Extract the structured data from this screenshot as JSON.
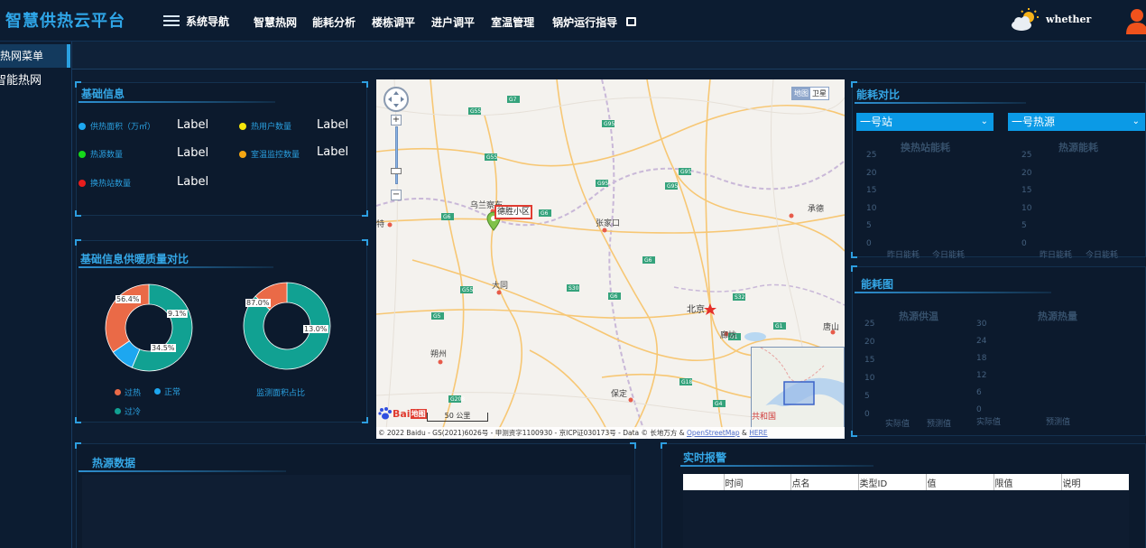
{
  "header": {
    "brand": "智慧供热云平台",
    "nav_toggle": "系统导航",
    "menu": [
      "智慧热网",
      "能耗分析",
      "楼栋调平",
      "进户调平",
      "室温管理",
      "锅炉运行指导"
    ],
    "weather": "whether"
  },
  "sidebar": {
    "items": [
      {
        "label": "热网菜单",
        "active": true
      },
      {
        "label": "智能热网",
        "active": false
      }
    ]
  },
  "basic_info": {
    "title": "基础信息",
    "rows": [
      {
        "label": "供热面积（万㎡）",
        "value": "Label",
        "color": "#1da7f0"
      },
      {
        "label": "热用户数量",
        "value": "Label",
        "color": "#f5e60b"
      },
      {
        "label": "热源数量",
        "value": "Label",
        "color": "#16d81a"
      },
      {
        "label": "室温监控数量",
        "value": "Label",
        "color": "#f5a612"
      },
      {
        "label": "换热站数量",
        "value": "Label",
        "color": "#e81d1d"
      }
    ]
  },
  "quality": {
    "title": "基础信息供暖质量对比",
    "legend": [
      {
        "label": "过热",
        "color": "#ea6a47"
      },
      {
        "label": "正常",
        "color": "#1da7f0"
      },
      {
        "label": "过冷",
        "color": "#11a192"
      }
    ],
    "monitor_label": "监测面积占比"
  },
  "chart_data": [
    {
      "type": "pie",
      "labels": [
        "过冷",
        "正常",
        "过热"
      ],
      "values": [
        56.4,
        9.1,
        34.5
      ],
      "value_labels": [
        "56.4%",
        "9.1%",
        "34.5%"
      ],
      "colors": [
        "#11a192",
        "#1da7f0",
        "#ea6a47"
      ],
      "donut": true
    },
    {
      "type": "pie",
      "values": [
        87.0,
        13.0
      ],
      "value_labels": [
        "87.0%",
        "13.0%"
      ],
      "colors": [
        "#11a192",
        "#ea6a47"
      ],
      "donut": true
    }
  ],
  "map": {
    "type_map": "地图",
    "type_sat": "卫星",
    "marker_label": "德胜小区",
    "scale_label": "50 公里",
    "copyright_prefix": "© 2022 Baidu - GS(2021)6026号 - 甲测资字1100930 - 京ICP证030173号 - Data © 长地万方 & ",
    "osm": "OpenStreetMap",
    "amp": " & ",
    "here": "HERE",
    "cities": [
      {
        "name": "乌兰察布"
      },
      {
        "name": "张家口"
      },
      {
        "name": "承德"
      },
      {
        "name": "大同"
      },
      {
        "name": "北京"
      },
      {
        "name": "廊坊"
      },
      {
        "name": "唐山"
      },
      {
        "name": "朔州"
      },
      {
        "name": "保定"
      },
      {
        "name": "特"
      }
    ],
    "overview_text": "共和国",
    "logo_bai": "Bai",
    "logo_du": "地图"
  },
  "energy_compare": {
    "title": "能耗对比",
    "select1": "一号站",
    "select2": "一号热源",
    "chart1_title": "换热站能耗",
    "chart2_title": "热源能耗",
    "y_ticks": [
      "25",
      "20",
      "15",
      "10",
      "5",
      "0"
    ],
    "x_labels": [
      "昨日能耗",
      "今日能耗"
    ]
  },
  "energy_graph": {
    "title": "能耗图",
    "chart1_title": "热源供温",
    "chart2_title": "热源热量",
    "y_ticks_left": [
      "25",
      "20",
      "15",
      "10",
      "5",
      "0"
    ],
    "y_ticks_right": [
      "30",
      "24",
      "18",
      "12",
      "6",
      "0"
    ],
    "x_labels": [
      "实际值",
      "预测值"
    ]
  },
  "heat_source": {
    "title": "热源数据"
  },
  "report": {
    "title": "实时报警",
    "columns": [
      "",
      "时间",
      "点名",
      "类型ID",
      "值",
      "限值",
      "说明"
    ]
  }
}
